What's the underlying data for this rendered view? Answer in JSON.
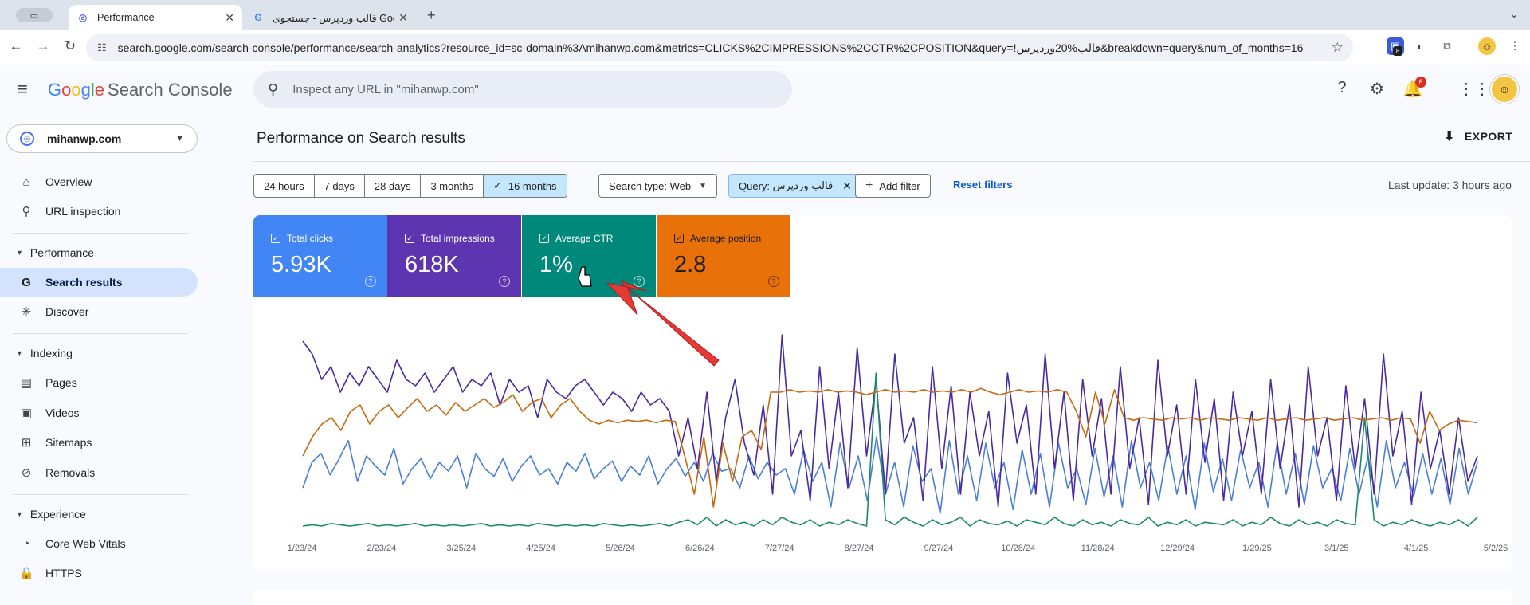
{
  "browser": {
    "tabs": [
      {
        "title": "Performance",
        "active": true
      },
      {
        "title": "قالب وردپرس - جستجوی Google",
        "active": false
      }
    ],
    "url": "search.google.com/search-console/performance/search-analytics?resource_id=sc-domain%3Amihanwp.com&metrics=CLICKS%2CIMPRESSIONS%2CCTR%2CPOSITION&query=!قالب%20وردپرس&breakdown=query&num_of_months=16",
    "extension_badge": "8"
  },
  "header": {
    "logo_google": [
      "G",
      "o",
      "o",
      "g",
      "l",
      "e"
    ],
    "logo_product": "Search Console",
    "search_placeholder": "Inspect any URL in \"mihanwp.com\"",
    "notification_count": "6"
  },
  "sidebar": {
    "property": "mihanwp.com",
    "items": [
      {
        "label": "Overview",
        "icon": "home-icon"
      },
      {
        "label": "URL inspection",
        "icon": "search-icon"
      }
    ],
    "performance": {
      "section": "Performance",
      "items": [
        {
          "label": "Search results",
          "icon": "google-g-icon",
          "selected": true
        },
        {
          "label": "Discover",
          "icon": "asterisk-icon"
        }
      ]
    },
    "indexing": {
      "section": "Indexing",
      "items": [
        {
          "label": "Pages",
          "icon": "pages-icon"
        },
        {
          "label": "Videos",
          "icon": "video-icon"
        },
        {
          "label": "Sitemaps",
          "icon": "sitemap-icon"
        },
        {
          "label": "Removals",
          "icon": "eye-off-icon"
        }
      ]
    },
    "experience": {
      "section": "Experience",
      "items": [
        {
          "label": "Core Web Vitals",
          "icon": "gauge-icon"
        },
        {
          "label": "HTTPS",
          "icon": "lock-icon"
        }
      ]
    }
  },
  "main": {
    "title": "Performance on Search results",
    "export_label": "EXPORT",
    "date_ranges": [
      "24 hours",
      "7 days",
      "28 days",
      "3 months",
      "16 months"
    ],
    "selected_range": "16 months",
    "search_type": "Search type: Web",
    "query_filter_label": "Query:",
    "query_filter_value": "قالب وردپرس",
    "add_filter": "Add filter",
    "reset_filters": "Reset filters",
    "last_update": "Last update: 3 hours ago"
  },
  "metrics": [
    {
      "label": "Total clicks",
      "value": "5.93K",
      "color": "#4285f4"
    },
    {
      "label": "Total impressions",
      "value": "618K",
      "color": "#5e35b1"
    },
    {
      "label": "Average CTR",
      "value": "1%",
      "color": "#00897b"
    },
    {
      "label": "Average position",
      "value": "2.8",
      "color": "#e8710a"
    }
  ],
  "chart_data": {
    "type": "line",
    "x_tick_labels": [
      "1/23/24",
      "2/23/24",
      "3/25/24",
      "4/25/24",
      "5/26/24",
      "6/26/24",
      "7/27/24",
      "8/27/24",
      "9/27/24",
      "10/28/24",
      "11/28/24",
      "12/29/24",
      "1/29/25",
      "3/1/25",
      "4/1/25",
      "5/2/25"
    ],
    "series": [
      {
        "name": "Total clicks",
        "color": "#4a7fd6",
        "values": [
          0.35,
          0.55,
          0.62,
          0.45,
          0.58,
          0.72,
          0.4,
          0.6,
          0.52,
          0.45,
          0.66,
          0.38,
          0.5,
          0.58,
          0.42,
          0.55,
          0.48,
          0.6,
          0.35,
          0.62,
          0.5,
          0.44,
          0.58,
          0.4,
          0.52,
          0.6,
          0.45,
          0.5,
          0.38,
          0.55,
          0.48,
          0.62,
          0.42,
          0.5,
          0.56,
          0.4,
          0.52,
          0.45,
          0.6,
          0.38,
          0.5,
          0.58,
          0.44,
          0.55,
          0.4,
          0.62,
          0.48,
          0.5,
          0.35,
          0.6,
          0.42,
          0.55,
          0.45,
          0.5,
          0.3,
          0.65,
          0.4,
          0.55,
          0.2,
          0.7,
          0.35,
          0.6,
          0.25,
          0.75,
          0.3,
          0.55,
          0.2,
          0.68,
          0.4,
          0.5,
          0.15,
          0.72,
          0.3,
          0.6,
          0.25,
          0.7,
          0.35,
          0.55,
          0.18,
          0.65,
          0.3,
          0.62,
          0.2,
          0.7,
          0.35,
          0.5,
          0.22,
          0.66,
          0.28,
          0.6,
          0.2,
          0.72,
          0.35,
          0.55,
          0.25,
          0.68,
          0.3,
          0.6,
          0.18,
          0.7,
          0.32,
          0.58,
          0.25,
          0.65,
          0.35,
          0.55,
          0.2,
          0.7,
          0.3,
          0.62,
          0.22,
          0.68,
          0.35,
          0.5,
          0.25,
          0.66,
          0.3,
          0.6,
          0.2,
          0.72,
          0.35,
          0.55,
          0.28,
          0.62,
          0.3,
          0.58,
          0.22,
          0.66,
          0.3,
          0.55
        ]
      },
      {
        "name": "Total impressions",
        "color": "#4b2aa0",
        "values": [
          1.5,
          1.4,
          1.2,
          1.3,
          1.1,
          1.25,
          1.15,
          1.3,
          1.2,
          1.1,
          1.35,
          1.2,
          1.15,
          1.25,
          1.1,
          1.2,
          1.3,
          1.1,
          1.2,
          1.15,
          1.25,
          1.0,
          1.2,
          1.1,
          1.15,
          0.9,
          1.2,
          1.1,
          1.05,
          1.15,
          1.2,
          1.1,
          1.0,
          1.1,
          1.05,
          0.95,
          1.1,
          1.0,
          1.05,
          0.95,
          0.6,
          0.9,
          0.5,
          1.1,
          0.4,
          0.9,
          1.2,
          0.7,
          0.45,
          1.0,
          0.3,
          1.55,
          0.6,
          0.8,
          0.25,
          1.3,
          0.5,
          1.1,
          0.35,
          1.45,
          0.6,
          1.2,
          0.3,
          1.4,
          0.7,
          0.9,
          0.25,
          1.3,
          0.5,
          1.15,
          0.3,
          1.1,
          0.6,
          0.95,
          0.2,
          1.25,
          0.7,
          1.0,
          0.3,
          1.4,
          0.5,
          1.1,
          0.25,
          1.2,
          0.6,
          1.05,
          0.3,
          1.3,
          0.5,
          0.9,
          0.22,
          1.35,
          0.6,
          1.0,
          0.3,
          1.2,
          0.55,
          1.05,
          0.25,
          1.1,
          0.6,
          0.95,
          0.3,
          1.2,
          0.5,
          1.0,
          0.2,
          1.3,
          0.6,
          0.9,
          0.25,
          1.15,
          0.5,
          1.05,
          0.3,
          1.4,
          0.6,
          0.95,
          0.22,
          1.1,
          0.5,
          0.8,
          0.3,
          0.9,
          0.4,
          0.6
        ]
      },
      {
        "name": "Average CTR",
        "color": "#1b8a6b",
        "values": [
          0.05,
          0.06,
          0.05,
          0.07,
          0.06,
          0.05,
          0.06,
          0.07,
          0.05,
          0.06,
          0.05,
          0.06,
          0.07,
          0.05,
          0.06,
          0.05,
          0.06,
          0.05,
          0.06,
          0.07,
          0.05,
          0.06,
          0.05,
          0.06,
          0.05,
          0.07,
          0.06,
          0.05,
          0.06,
          0.05,
          0.06,
          0.05,
          0.07,
          0.06,
          0.05,
          0.06,
          0.05,
          0.06,
          0.07,
          0.05,
          0.08,
          0.1,
          0.06,
          0.12,
          0.05,
          0.1,
          0.06,
          0.08,
          0.05,
          0.1,
          0.06,
          0.12,
          0.08,
          0.06,
          0.1,
          0.05,
          0.08,
          0.06,
          0.1,
          0.07,
          0.05,
          1.25,
          0.1,
          0.06,
          0.12,
          0.08,
          0.05,
          0.1,
          0.06,
          0.08,
          0.12,
          0.05,
          0.1,
          0.07,
          0.06,
          0.09,
          0.05,
          0.1,
          0.08,
          0.06,
          0.12,
          0.07,
          0.05,
          0.1,
          0.06,
          0.08,
          0.05,
          0.1,
          0.07,
          0.06,
          0.12,
          0.05,
          0.08,
          0.06,
          0.1,
          0.05,
          0.08,
          0.07,
          0.06,
          0.1,
          0.05,
          0.08,
          0.06,
          0.12,
          0.07,
          0.05,
          0.1,
          0.06,
          0.08,
          0.05,
          0.1,
          0.07,
          0.06,
          0.9,
          0.1,
          0.05,
          0.08,
          0.06,
          0.1,
          0.07,
          0.05,
          0.08,
          0.06,
          0.1,
          0.05,
          0.12
        ]
      },
      {
        "name": "Average position",
        "color": "#c66a12",
        "values": [
          0.6,
          0.75,
          0.85,
          0.9,
          0.8,
          0.95,
          1.0,
          0.85,
          0.95,
          1.0,
          0.9,
          0.98,
          1.05,
          0.95,
          1.0,
          0.92,
          1.02,
          0.95,
          1.0,
          1.05,
          0.98,
          1.02,
          1.08,
          0.95,
          1.02,
          1.05,
          0.9,
          1.0,
          1.05,
          0.95,
          0.88,
          0.85,
          0.88,
          0.86,
          0.88,
          0.87,
          0.88,
          0.86,
          0.88,
          0.87,
          0.6,
          0.3,
          0.75,
          0.2,
          0.7,
          0.4,
          0.75,
          0.8,
          0.65,
          1.1,
          1.1,
          1.12,
          1.1,
          1.11,
          1.1,
          1.12,
          1.1,
          1.11,
          1.1,
          1.08,
          1.1,
          1.12,
          1.1,
          1.11,
          1.1,
          1.12,
          1.1,
          1.11,
          1.1,
          1.12,
          1.1,
          1.13,
          1.1,
          1.08,
          1.1,
          1.12,
          1.1,
          1.11,
          1.1,
          1.12,
          1.1,
          0.95,
          0.75,
          1.1,
          0.85,
          1.12,
          0.9,
          0.88,
          0.9,
          0.89,
          0.88,
          0.9,
          0.89,
          0.9,
          0.88,
          0.9,
          0.89,
          0.88,
          0.9,
          0.89,
          0.88,
          0.9,
          0.88,
          0.89,
          0.9,
          0.88,
          0.89,
          0.9,
          0.88,
          0.89,
          0.9,
          0.88,
          0.89,
          0.9,
          0.88,
          0.9,
          0.89,
          0.7,
          0.95,
          0.8,
          0.85,
          0.88,
          0.87,
          0.86
        ]
      }
    ]
  }
}
